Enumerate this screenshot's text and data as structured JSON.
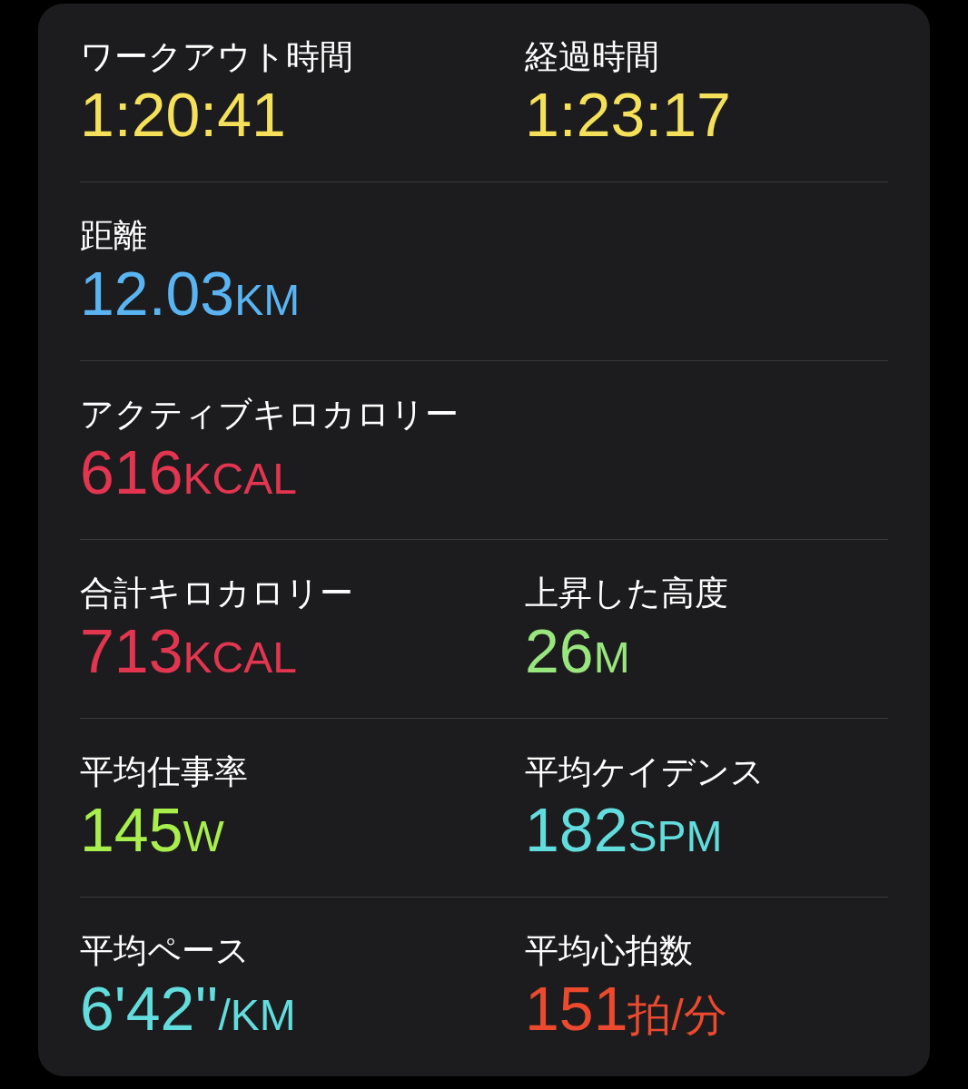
{
  "rows": [
    {
      "metrics": [
        {
          "label": "ワークアウト時間",
          "value": "1:20:41",
          "color": "#f5e05a"
        },
        {
          "label": "経過時間",
          "value": "1:23:17",
          "color": "#f5e05a"
        }
      ]
    },
    {
      "metrics": [
        {
          "label": "距離",
          "value": "12.03",
          "unit": "KM",
          "color": "#5ab4f2"
        }
      ]
    },
    {
      "metrics": [
        {
          "label": "アクティブキロカロリー",
          "value": "616",
          "unit": "KCAL",
          "color": "#e2354f"
        }
      ]
    },
    {
      "metrics": [
        {
          "label": "合計キロカロリー",
          "value": "713",
          "unit": "KCAL",
          "color": "#e2354f"
        },
        {
          "label": "上昇した高度",
          "value": "26",
          "unit": "M",
          "color": "#9ae67e"
        }
      ]
    },
    {
      "metrics": [
        {
          "label": "平均仕事率",
          "value": "145",
          "unit": "W",
          "color": "#a8ee4c"
        },
        {
          "label": "平均ケイデンス",
          "value": "182",
          "unit": "SPM",
          "color": "#62dcdc"
        }
      ]
    },
    {
      "metrics": [
        {
          "label": "平均ペース",
          "value": "6'42''",
          "unit": "/KM",
          "color": "#62dcdc"
        },
        {
          "label": "平均心拍数",
          "value": "151",
          "unit": "拍/分",
          "color": "#ec4a2e"
        }
      ]
    }
  ]
}
